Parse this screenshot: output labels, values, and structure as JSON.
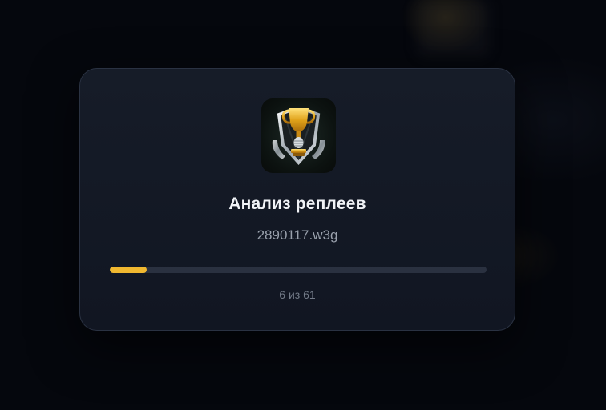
{
  "dialog": {
    "title": "Анализ реплеев",
    "filename": "2890117.w3g",
    "progress": {
      "current": 6,
      "total": 61,
      "label": "6 из 61",
      "fill_color": "#f0b830",
      "track_color": "#2a3140"
    },
    "icon": "trophy-shield-icon"
  }
}
